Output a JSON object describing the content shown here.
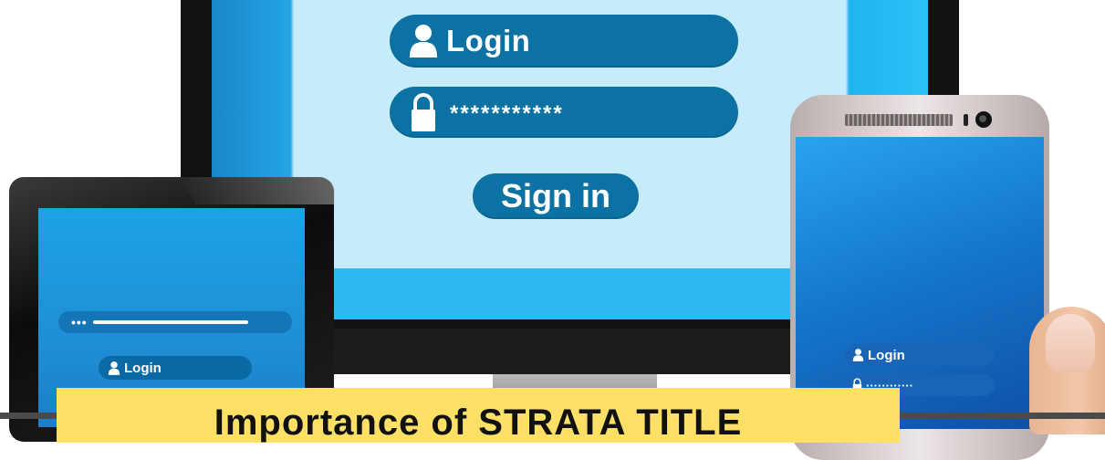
{
  "monitor": {
    "login_label": "Login",
    "password_mask": "***********",
    "signin_label": "Sign in",
    "icons": {
      "user": "user-icon",
      "lock": "lock-icon"
    }
  },
  "tablet": {
    "url_dots": "•••",
    "login_label": "Login"
  },
  "phone": {
    "login_label": "Login",
    "password_mask": "············"
  },
  "caption": {
    "text": "Importance of STRATA TITLE"
  },
  "colors": {
    "pill_blue": "#0b72a3",
    "screen_light": "#c6ecfb",
    "caption_bg": "#ffe066"
  }
}
